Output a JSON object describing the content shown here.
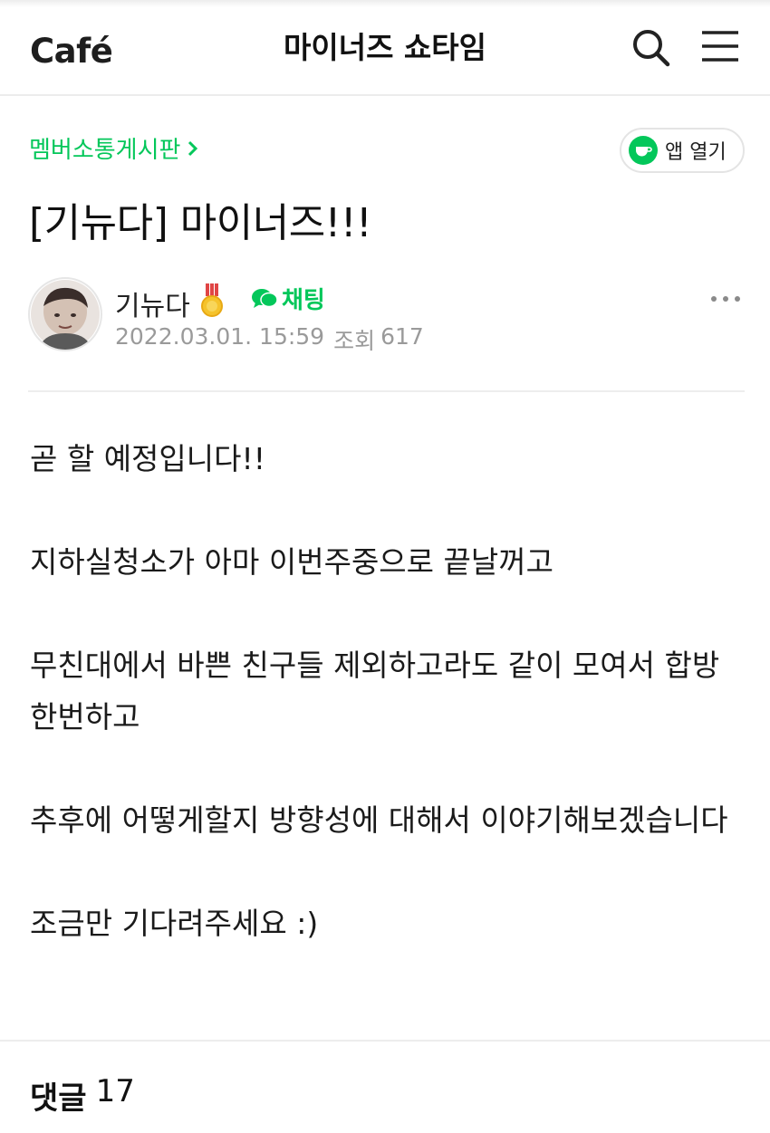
{
  "header": {
    "logo_text": "Café",
    "cafe_name": "마이너즈 쇼타임",
    "search_icon": "search-icon",
    "menu_icon": "hamburger-menu-icon"
  },
  "article": {
    "board_name": "멤버소통게시판",
    "app_open_label": "앱 열기",
    "title": "[기뉴다] 마이너즈!!!",
    "author": {
      "name": "기뉴다",
      "badge_icon": "medal-icon",
      "chat_label": "채팅",
      "date": "2022.03.01. 15:59",
      "views_label": "조회",
      "views": "617"
    },
    "paragraphs": [
      "곧 할 예정입니다!!",
      "지하실청소가 아마 이번주중으로 끝날꺼고",
      "무친대에서 바쁜 친구들 제외하고라도 같이 모여서 합방한번하고",
      "추후에 어떻게할지 방향성에 대해서 이야기해보겠습니다",
      "조금만 기다려주세요 :)"
    ]
  },
  "comments": {
    "label": "댓글",
    "count": "17"
  },
  "colors": {
    "accent": "#03c75a",
    "muted": "#9a9a9a",
    "divider": "#ededed"
  }
}
